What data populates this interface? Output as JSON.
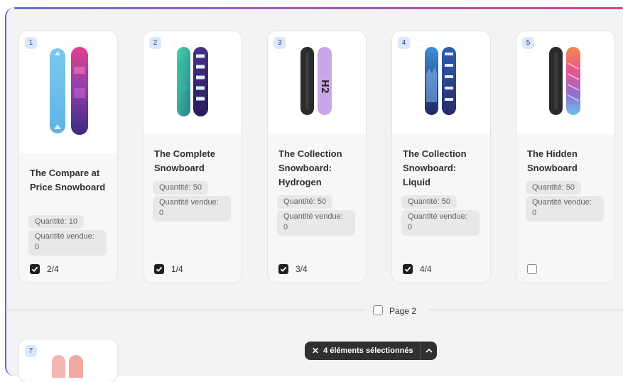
{
  "page1": {
    "cards": [
      {
        "number": "1",
        "title": "The Compare at Price Snowboard",
        "quantity": "Quantité: 10",
        "sold": "Quantité vendue: 0",
        "checked": true,
        "position": "2/4"
      },
      {
        "number": "2",
        "title": "The Complete Snowboard",
        "quantity": "Quantité: 50",
        "sold": "Quantité vendue: 0",
        "checked": true,
        "position": "1/4"
      },
      {
        "number": "3",
        "title": "The Collection Snowboard: Hydrogen",
        "quantity": "Quantité: 50",
        "sold": "Quantité vendue: 0",
        "checked": true,
        "position": "3/4"
      },
      {
        "number": "4",
        "title": "The Collection Snowboard: Liquid",
        "quantity": "Quantité: 50",
        "sold": "Quantité vendue: 0",
        "checked": true,
        "position": "4/4"
      },
      {
        "number": "5",
        "title": "The Hidden Snowboard",
        "quantity": "Quantité: 50",
        "sold": "Quantité vendue: 0",
        "checked": false,
        "position": ""
      }
    ]
  },
  "page2": {
    "label": "Page 2",
    "cards": [
      {
        "number": "7"
      }
    ]
  },
  "selection_bar": {
    "close": "✕",
    "text": "4 éléments sélectionnés"
  },
  "icons": {
    "check": "checkmark-icon",
    "close": "close-icon",
    "chevron": "chevron-up-icon"
  },
  "colors": {
    "accent_blue": "#5b6fd6",
    "accent_pink": "#d6457a",
    "selection_bar": "#303030",
    "number_badge": "#dce7fb"
  }
}
